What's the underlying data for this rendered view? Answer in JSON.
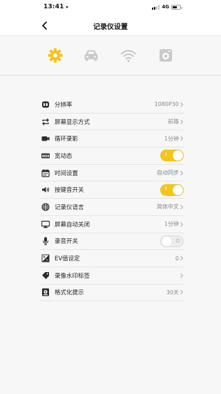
{
  "status_bar": {
    "time": "13:41",
    "network": "4G"
  },
  "header": {
    "title": "记录仪设置"
  },
  "tabs": [
    {
      "name": "gear",
      "active": true
    },
    {
      "name": "car",
      "active": false
    },
    {
      "name": "wifi",
      "active": false
    },
    {
      "name": "storage",
      "active": false
    }
  ],
  "colors": {
    "accent": "#f5c518",
    "icon": "#2b2b2b",
    "inactive_tab": "#c9c9c9"
  },
  "settings": [
    {
      "label": "分辨率",
      "value": "1080P30",
      "type": "nav",
      "icon": "resolution-icon"
    },
    {
      "label": "屏幕显示方式",
      "value": "前路",
      "type": "nav",
      "icon": "swap-icon"
    },
    {
      "label": "循环录影",
      "value": "1分钟",
      "type": "nav",
      "icon": "video-camera-icon"
    },
    {
      "label": "宽动态",
      "value": "",
      "type": "toggle",
      "on": true,
      "toggle_mark": "I",
      "icon": "wdr-icon"
    },
    {
      "label": "时间设置",
      "value": "自动同步",
      "type": "nav",
      "icon": "calendar-icon"
    },
    {
      "label": "按键音开关",
      "value": "",
      "type": "toggle",
      "on": true,
      "toggle_mark": "I",
      "icon": "speaker-icon"
    },
    {
      "label": "记录仪语言",
      "value": "简体中文",
      "type": "nav",
      "icon": "globe-icon"
    },
    {
      "label": "屏幕自动关闭",
      "value": "1分钟",
      "type": "nav",
      "icon": "monitor-icon"
    },
    {
      "label": "录音开关",
      "value": "",
      "type": "toggle",
      "on": false,
      "toggle_mark": "O",
      "icon": "microphone-icon"
    },
    {
      "label": "EV值设定",
      "value": "0",
      "type": "nav",
      "icon": "exposure-icon"
    },
    {
      "label": "录像水印标签",
      "value": "",
      "type": "nav",
      "icon": "tag-icon"
    },
    {
      "label": "格式化提示",
      "value": "30天",
      "type": "nav",
      "icon": "sd-card-icon"
    }
  ]
}
